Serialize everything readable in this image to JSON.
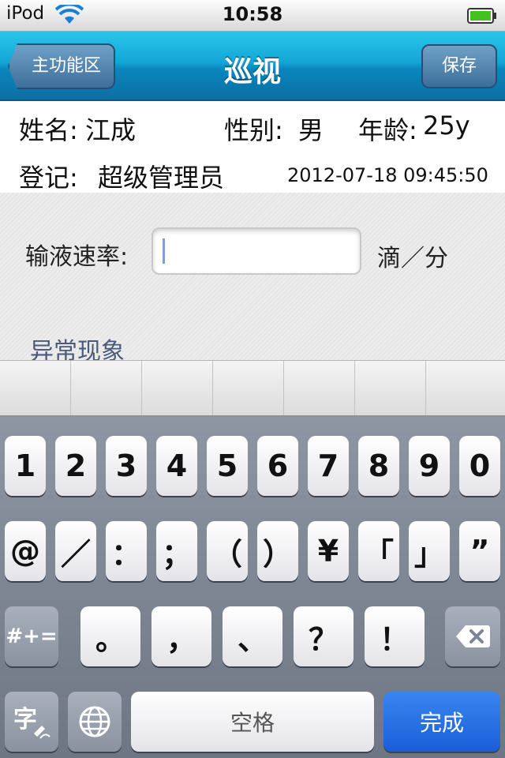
{
  "status_bar": {
    "carrier": "iPod",
    "time": "10:58"
  },
  "nav": {
    "back_label": "主功能区",
    "title": "巡视",
    "save_label": "保存"
  },
  "patient": {
    "name_label": "姓名:",
    "name": "江成",
    "gender_label": "性别:",
    "gender": "男",
    "age_label": "年龄:",
    "age": "25y",
    "register_label": "登记:",
    "registrar": "超级管理员",
    "datetime": "2012-07-18 09:45:50"
  },
  "form": {
    "rate_label": "输液速率:",
    "rate_value": "",
    "rate_unit": "滴／分",
    "abnormal_label": "异常现象"
  },
  "keyboard": {
    "row1": [
      "1",
      "2",
      "3",
      "4",
      "5",
      "6",
      "7",
      "8",
      "9",
      "0"
    ],
    "row2": [
      "@",
      "／",
      "：",
      "；",
      "（",
      "）",
      "¥",
      "「",
      "」",
      "”"
    ],
    "row3_mode": "#+=",
    "row3": [
      "。",
      "，",
      "、",
      "？",
      "！"
    ],
    "space_label": "空格",
    "done_label": "完成",
    "icons": {
      "input_mode": "handwriting-icon",
      "globe": "globe-icon",
      "delete": "backspace-icon"
    }
  },
  "colors": {
    "nav_blue": "#14a6d6",
    "done_blue": "#1a5ed8",
    "battery_green": "#45c01e"
  }
}
